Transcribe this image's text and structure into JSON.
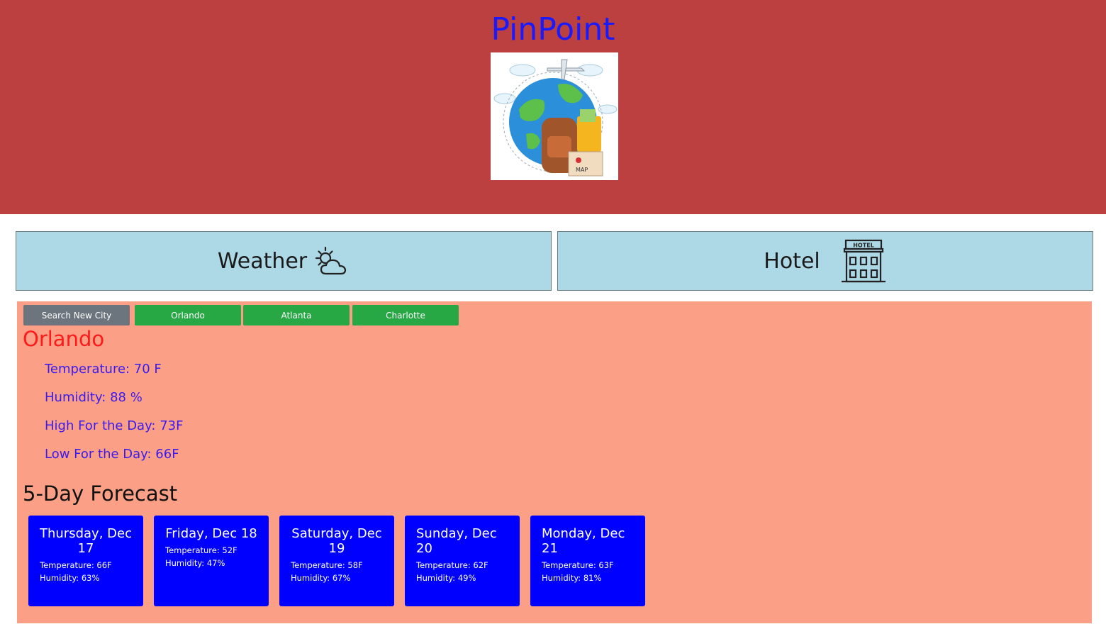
{
  "header": {
    "title": "PinPoint",
    "title_color": "#1a1aff",
    "background": "#bc4040",
    "logo_icon": "travel-globe-icon"
  },
  "nav": {
    "weather_label": "Weather",
    "weather_icon": "weather-partly-cloudy-icon",
    "hotel_label": "Hotel",
    "hotel_icon": "hotel-building-icon",
    "hotel_sign": "HOTEL"
  },
  "search": {
    "search_label": "Search New City",
    "saved_cities": [
      "Orlando",
      "Atlanta",
      "Charlotte"
    ]
  },
  "current": {
    "city": "Orlando",
    "temperature": "Temperature: 70 F",
    "humidity": "Humidity: 88 %",
    "high": "High For the Day: 73F",
    "low": "Low For the Day: 66F"
  },
  "forecast": {
    "title": "5-Day Forecast",
    "days": [
      {
        "day": "Thursday, Dec 17",
        "temperature": "Temperature: 66F",
        "humidity": "Humidity: 63%"
      },
      {
        "day": "Friday, Dec 18",
        "temperature": "Temperature: 52F",
        "humidity": "Humidity: 47%"
      },
      {
        "day": "Saturday, Dec 19",
        "temperature": "Temperature: 58F",
        "humidity": "Humidity: 67%"
      },
      {
        "day": "Sunday, Dec 20",
        "temperature": "Temperature: 62F",
        "humidity": "Humidity: 49%"
      },
      {
        "day": "Monday, Dec 21",
        "temperature": "Temperature: 63F",
        "humidity": "Humidity: 81%"
      }
    ]
  },
  "colors": {
    "nav_background": "#add8e6",
    "panel_background": "#fba087",
    "city_button": "#28a745",
    "search_button": "#6c757d",
    "card_background": "#0000ff",
    "city_name": "#ff1a1a",
    "stat_text": "#3a1af0"
  }
}
